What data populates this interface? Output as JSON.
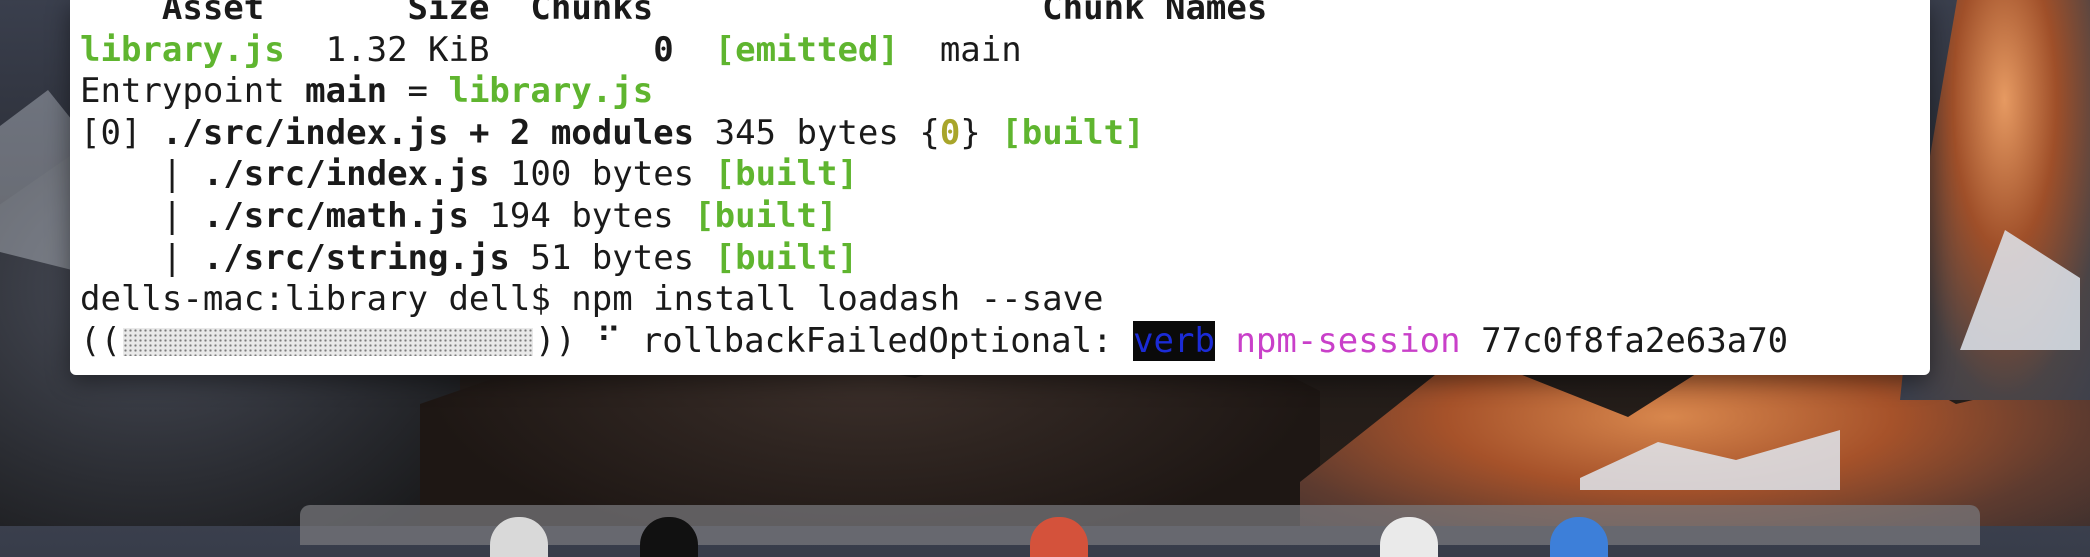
{
  "terminal": {
    "header": {
      "asset": "Asset",
      "size": "Size",
      "chunks": "Chunks",
      "chunk_names": "Chunk Names"
    },
    "asset_row": {
      "file": "library.js",
      "size": "1.32 KiB",
      "chunk": "0",
      "status": "[emitted]",
      "chunk_name": "main"
    },
    "entrypoint": {
      "prefix": "Entrypoint ",
      "name": "main",
      "eq": " = ",
      "file": "library.js"
    },
    "module_main": {
      "id": "[0]",
      "path": "./src/index.js + 2 modules",
      "size": "345 bytes",
      "brace_open": "{",
      "chunk": "0",
      "brace_close": "}",
      "status": "[built]"
    },
    "submodules": [
      {
        "pipe": "|",
        "path": "./src/index.js",
        "size": "100 bytes",
        "status": "[built]"
      },
      {
        "pipe": "|",
        "path": "./src/math.js",
        "size": "194 bytes",
        "status": "[built]"
      },
      {
        "pipe": "|",
        "path": "./src/string.js",
        "size": "51 bytes",
        "status": "[built]"
      }
    ],
    "prompt": {
      "text": "dells-mac:library dell$",
      "command": "npm install loadash --save"
    },
    "progress": {
      "open": "((",
      "close": "))",
      "spinner": "⠋",
      "task": "rollbackFailedOptional:",
      "level": "verb",
      "session_label": "npm-session",
      "session_id": "77c0f8fa2e63a70",
      "fill_fraction": 0.0
    }
  },
  "colors": {
    "green": "#5fb52f",
    "yellow": "#a8a52a",
    "magenta": "#c940c9",
    "highlight_bg": "#0a0a0a",
    "highlight_fg": "#1b2bd6"
  }
}
